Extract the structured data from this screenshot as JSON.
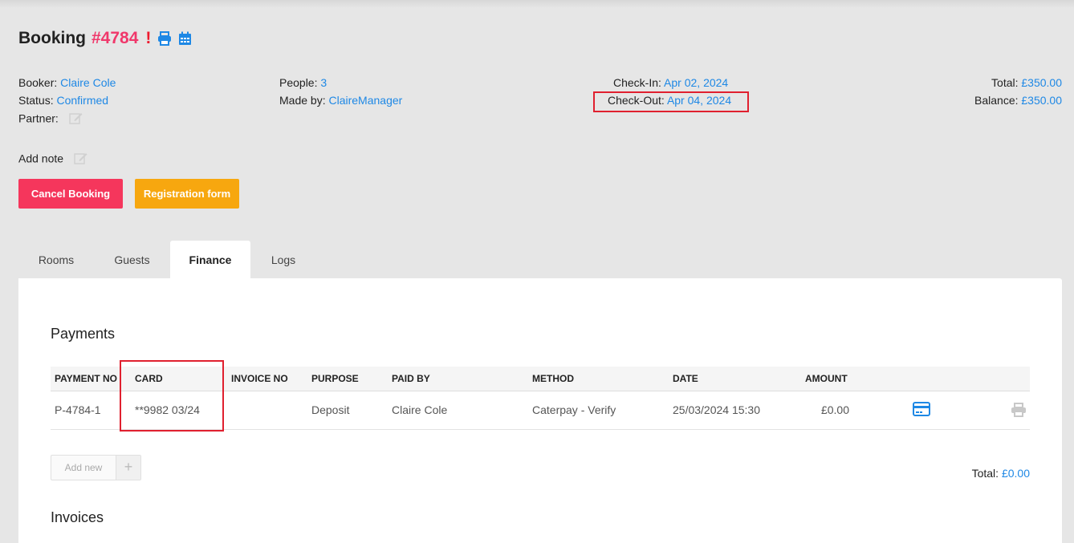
{
  "booking": {
    "title_label": "Booking",
    "number": "#4784",
    "alert": "!",
    "icons": [
      "print-icon",
      "calendar-icon"
    ]
  },
  "info": {
    "booker_label": "Booker:",
    "booker_value": "Claire Cole",
    "status_label": "Status:",
    "status_value": "Confirmed",
    "partner_label": "Partner:",
    "people_label": "People:",
    "people_value": "3",
    "made_by_label": "Made by:",
    "made_by_value": "ClaireManager",
    "checkin_label": "Check-In:",
    "checkin_value": "Apr 02, 2024",
    "checkout_label": "Check-Out:",
    "checkout_value": "Apr 04, 2024",
    "total_label": "Total:",
    "total_value": "£350.00",
    "balance_label": "Balance:",
    "balance_value": "£350.00"
  },
  "note": {
    "add_label": "Add note"
  },
  "actions": {
    "cancel_label": "Cancel Booking",
    "registration_label": "Registration form"
  },
  "tabs": [
    {
      "label": "Rooms"
    },
    {
      "label": "Guests"
    },
    {
      "label": "Finance",
      "active": true
    },
    {
      "label": "Logs"
    }
  ],
  "payments": {
    "title": "Payments",
    "columns": [
      "PAYMENT NO",
      "CARD",
      "INVOICE NO",
      "PURPOSE",
      "PAID BY",
      "METHOD",
      "DATE",
      "AMOUNT"
    ],
    "rows": [
      {
        "payment_no": "P-4784-1",
        "card": "**9982 03/24",
        "invoice_no": "",
        "purpose": "Deposit",
        "paid_by": "Claire Cole",
        "method": "Caterpay - Verify",
        "date": "25/03/2024 15:30",
        "amount": "£0.00",
        "icons": [
          "credit-card-icon",
          "print-icon"
        ]
      }
    ],
    "add_new_label": "Add new",
    "total_label": "Total:",
    "total_value": "£0.00"
  },
  "invoices": {
    "title": "Invoices"
  },
  "colors": {
    "accent": "#1e88e5",
    "danger": "#f5365c",
    "warning": "#f7a70f",
    "alert": "#ee1b2e",
    "highlight_box": "#e0202f"
  }
}
